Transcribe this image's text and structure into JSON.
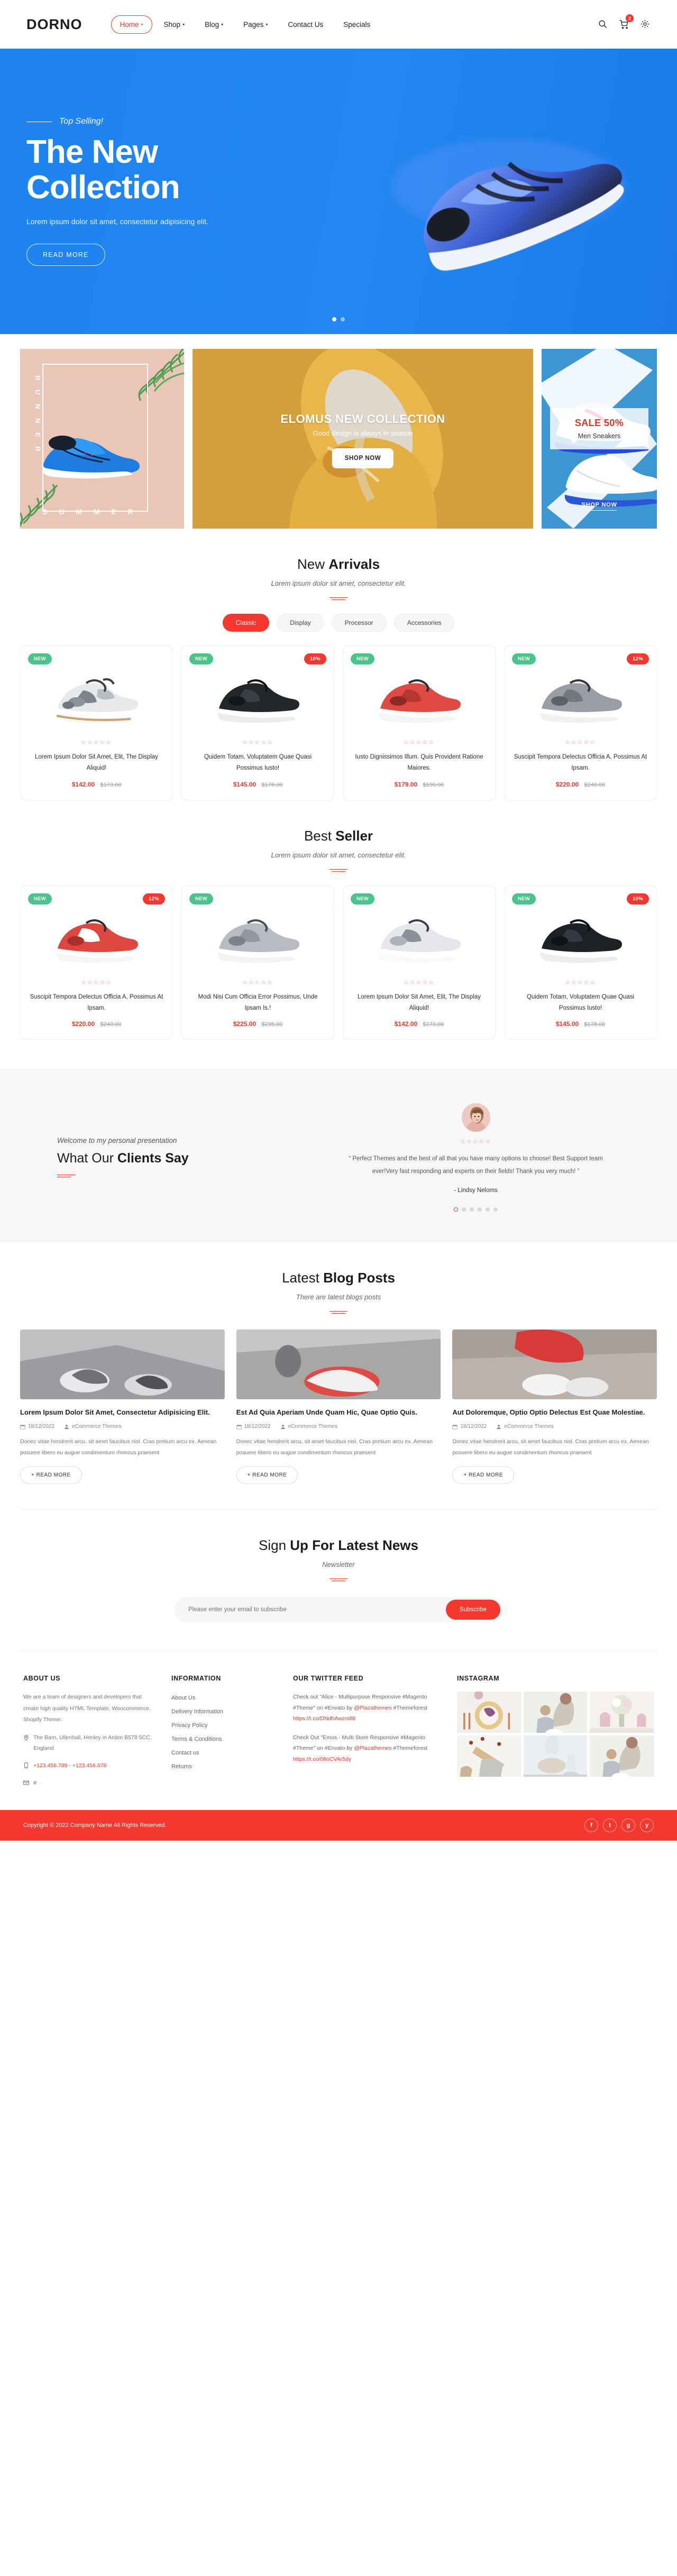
{
  "header": {
    "logo": "DORNO",
    "nav": [
      {
        "label": "Home",
        "caret": true,
        "active": true
      },
      {
        "label": "Shop",
        "caret": true,
        "active": false
      },
      {
        "label": "Blog",
        "caret": true,
        "active": false
      },
      {
        "label": "Pages",
        "caret": true,
        "active": false
      },
      {
        "label": "Contact Us",
        "caret": false,
        "active": false
      },
      {
        "label": "Specials",
        "caret": false,
        "active": false
      }
    ],
    "cart_count": "2"
  },
  "hero": {
    "eyebrow": "Top Selling!",
    "title_line1": "The New",
    "title_line2": "Collection",
    "subtitle": "Lorem ipsum dolor sit amet, consectetur adipisicing elit.",
    "button": "READ MORE",
    "dots": 2,
    "active_dot": 0,
    "bg_color": "#2287f2"
  },
  "banners": {
    "left": {
      "vertical": "R U N N E R",
      "bottom": "S U M M E R"
    },
    "center": {
      "title": "ELOMUS NEW COLLECTION",
      "subtitle": "Good design is always in season",
      "button": "SHOP NOW"
    },
    "right": {
      "sale": "SALE 50%",
      "caption": "Men Sneakers",
      "button": "SHOP NOW"
    }
  },
  "new_arrivals": {
    "title_light": "New ",
    "title_bold": "Arrivals",
    "subtitle": "Lorem ipsum dolor sit amet, consectetur elit.",
    "tabs": [
      {
        "label": "Classic",
        "active": true
      },
      {
        "label": "Display",
        "active": false
      },
      {
        "label": "Processor",
        "active": false
      },
      {
        "label": "Accessories",
        "active": false
      }
    ],
    "products": [
      {
        "badge_new": "NEW",
        "badge_off": "",
        "stars": "☆☆☆☆☆",
        "title": "Lorem Ipsum Dolor Sit Amet, Elit, The Display Aliquid!",
        "price": "$142.00",
        "old_price": "$173.00"
      },
      {
        "badge_new": "NEW",
        "badge_off": "10%",
        "stars": "☆☆☆☆☆",
        "title": "Quidem Totam, Voluptatem Quae Quasi Possimus Iusto!",
        "price": "$145.00",
        "old_price": "$178.00"
      },
      {
        "badge_new": "NEW",
        "badge_off": "",
        "stars": "☆☆☆☆☆",
        "title": "Iusto Dignissimos Illum. Quis Provident Ratione Maiores.",
        "price": "$179.00",
        "old_price": "$190.00"
      },
      {
        "badge_new": "NEW",
        "badge_off": "12%",
        "stars": "☆☆☆☆☆",
        "title": "Suscipit Tempora Delectus Officia A, Possimus At Ipsam.",
        "price": "$220.00",
        "old_price": "$240.00"
      }
    ]
  },
  "best_seller": {
    "title_light": "Best ",
    "title_bold": "Seller",
    "subtitle": "Lorem ipsum dolor sit amet, consectetur elit.",
    "products": [
      {
        "badge_new": "NEW",
        "badge_off": "12%",
        "stars": "☆☆☆☆☆",
        "title": "Suscipit Tempora Delectus Officia A, Possimus At Ipsam.",
        "price": "$220.00",
        "old_price": "$240.00"
      },
      {
        "badge_new": "NEW",
        "badge_off": "",
        "stars": "☆☆☆☆☆",
        "title": "Modi Nisi Cum Officia Error Possimus, Unde Ipsam Is.!",
        "price": "$225.00",
        "old_price": "$235.00"
      },
      {
        "badge_new": "NEW",
        "badge_off": "",
        "stars": "☆☆☆☆☆",
        "title": "Lorem Ipsum Dolor Sit Amet, Elit, The Display Aliquid!",
        "price": "$142.00",
        "old_price": "$173.00"
      },
      {
        "badge_new": "NEW",
        "badge_off": "10%",
        "stars": "☆☆☆☆☆",
        "title": "Quidem Totam, Voluptatem Quae Quasi Possimus Iusto!",
        "price": "$145.00",
        "old_price": "$178.00"
      }
    ]
  },
  "testimonial": {
    "welcome": "Welcome to my personal presentation",
    "title_light": "What Our ",
    "title_bold": "Clients Say",
    "stars": "☆☆☆☆☆",
    "quote": "“ Perfect Themes and the best of all that you have many options to choose! Best Support team ever!Very fast responding and experts on their fields! Thank you very much! ”",
    "author": "- Lindsy Neloms",
    "dots": 6,
    "active_dot": 0
  },
  "blog": {
    "title_light": "Latest ",
    "title_bold": "Blog Posts",
    "subtitle": "There are latest blogs posts",
    "posts": [
      {
        "title": "Lorem Ipsum Dolor Sit Amet, Consectetur Adipisicing Elit.",
        "date": "18/12/2022",
        "author": "eCommerce Themes",
        "excerpt": "Donec vitae hendrerit arcu, sit amet faucibus nisl. Cras pretium arcu ex. Aenean posuere libero eu augue condimentum rhoncus praesent",
        "button": "+ READ MORE"
      },
      {
        "title": "Est Ad Quia Aperiam Unde Quam Hic, Quae Optio Quis.",
        "date": "18/12/2022",
        "author": "eCommerce Themes",
        "excerpt": "Donec vitae hendrerit arcu, sit amet faucibus nisl. Cras pretium arcu ex. Aenean posuere libero eu augue condimentum rhoncus praesent",
        "button": "+ READ MORE"
      },
      {
        "title": "Aut Doloremque, Optio Optio Delectus Est Quae Molestiae.",
        "date": "18/12/2022",
        "author": "eCommerce Themes",
        "excerpt": "Donec vitae hendrerit arcu, sit amet faucibus nisl. Cras pretium arcu ex. Aenean posuere libero eu augue condimentum rhoncus praesent",
        "button": "+ READ MORE"
      }
    ]
  },
  "newsletter": {
    "title_light": "Sign ",
    "title_bold": "Up For Latest News",
    "subtitle": "Newsletter",
    "placeholder": "Please enter your email to subscribe",
    "button": "Subscribe"
  },
  "footer": {
    "about": {
      "heading": "ABOUT US",
      "text": "We are a team of designers and developers that create high quality HTML Template, Woocommerce, Shopify Theme.",
      "address": "The Barn, Ullenhall, Henley in Arden B578 5CC, England",
      "phone": "+123.456.789 - +123.456.678",
      "email": "#"
    },
    "information": {
      "heading": "INFORMATION",
      "links": [
        "About Us",
        "Delivery Information",
        "Privacy Policy",
        "Terms & Conditions",
        "Contact us",
        "Returns"
      ]
    },
    "twitter": {
      "heading": "OUR TWITTER FEED",
      "tweets": [
        {
          "text1": "Check out \"Alice - Multipurpose Responsive #Magento #Theme\" on #Envato by ",
          "handle": "@Plazathemes",
          "text2": " #Themeforest ",
          "link": "https://t.co/DNdhAwzm88"
        },
        {
          "text1": "Check Out \"Emos - Multi Store Responsive #Magento #Theme\" on #Envato by ",
          "handle": "@Plazathemes",
          "text2": " #Themeforest ",
          "link": "https://t.co/08oCVAr5dy"
        }
      ]
    },
    "instagram": {
      "heading": "INSTAGRAM",
      "cells": 6
    }
  },
  "copyright": {
    "text": "Copyright © 2022.Company Name All Rights Reserved.",
    "socials": [
      "f",
      "t",
      "g",
      "y"
    ],
    "bar_color": "#f4372f"
  }
}
